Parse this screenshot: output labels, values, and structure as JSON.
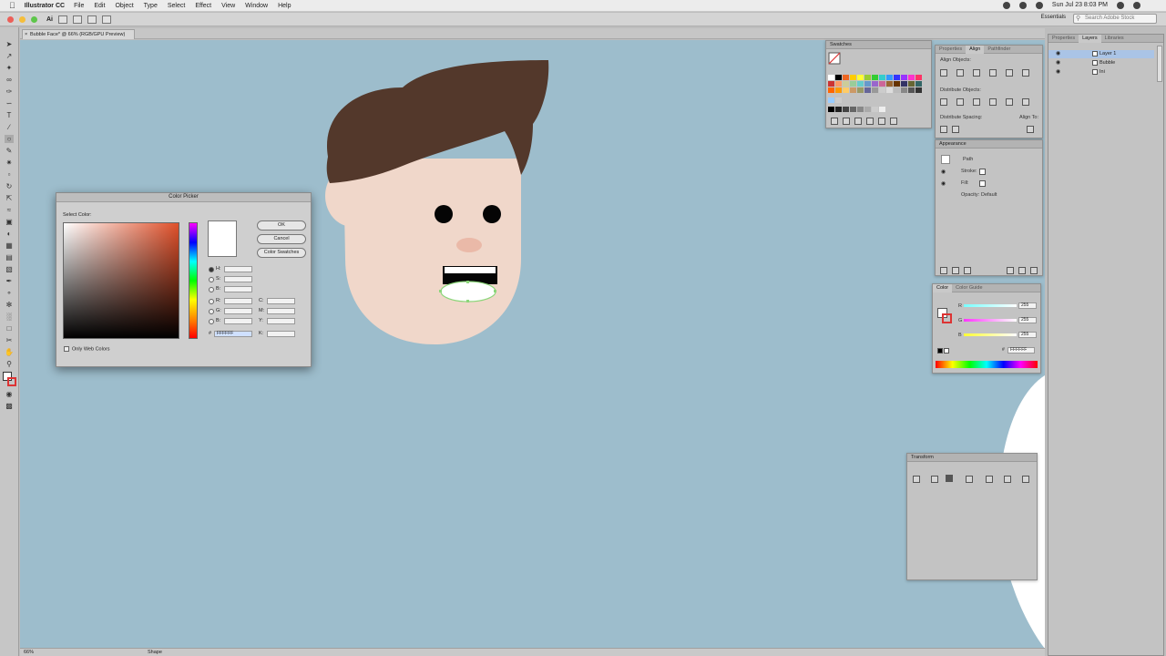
{
  "menubar": {
    "app_name": "Illustrator CC",
    "items": [
      "File",
      "Edit",
      "Object",
      "Type",
      "Select",
      "Effect",
      "View",
      "Window",
      "Help"
    ],
    "clock": "Sun Jul 23  8:03 PM"
  },
  "appbar": {
    "workspace": "Essentials",
    "search_placeholder": "Search Adobe Stock"
  },
  "document": {
    "tab_title": "Bubble Face* @ 66% (RGB/GPU Preview)",
    "zoom": "66%"
  },
  "colors": {
    "canvas_bg": "#9dbdcc",
    "hair": "#53382b",
    "skin": "#f0d7ca",
    "nose": "#eab9a8",
    "eyes": "#050505",
    "mouth_fill": "#ffffff"
  },
  "color_picker": {
    "title": "Color Picker",
    "select_label": "Select Color:",
    "ok": "OK",
    "cancel": "Cancel",
    "swatches": "Color Swatches",
    "h": "H:",
    "s": "S:",
    "b": "B:",
    "r": "R:",
    "g": "G:",
    "bl": "B:",
    "hex": "#",
    "c": "C:",
    "m": "M:",
    "y": "Y:",
    "k": "K:",
    "hex_value": "FFFFFF",
    "web_only": "Only Web Colors"
  },
  "swatches_panel": {
    "title": "Swatches"
  },
  "properties_panel": {
    "tabs": [
      "Properties",
      "Align",
      "Pathfinder"
    ],
    "align_objects": "Align Objects:",
    "distribute_objects": "Distribute Objects:",
    "distribute_spacing": "Distribute Spacing:",
    "align_to": "Align To:"
  },
  "appearance_panel": {
    "title": "Appearance",
    "path_label": "Path",
    "stroke_label": "Stroke:",
    "fill_label": "Fill:",
    "opacity_label": "Opacity:",
    "opacity_value": "Default"
  },
  "color_panel": {
    "tabs": [
      "Color",
      "Color Guide"
    ],
    "r": "R",
    "g": "G",
    "b": "B",
    "r_value": "255",
    "g_value": "255",
    "b_value": "255",
    "hex": "FFFFFF"
  },
  "layers_panel": {
    "tabs": [
      "Properties",
      "Layers",
      "Libraries"
    ],
    "rows": [
      "Layer 1",
      "Bubble",
      "Ini"
    ]
  },
  "transform_panel": {
    "title": "Transform"
  },
  "statusbar": {
    "zoom": "66%",
    "tool": "Shape"
  }
}
